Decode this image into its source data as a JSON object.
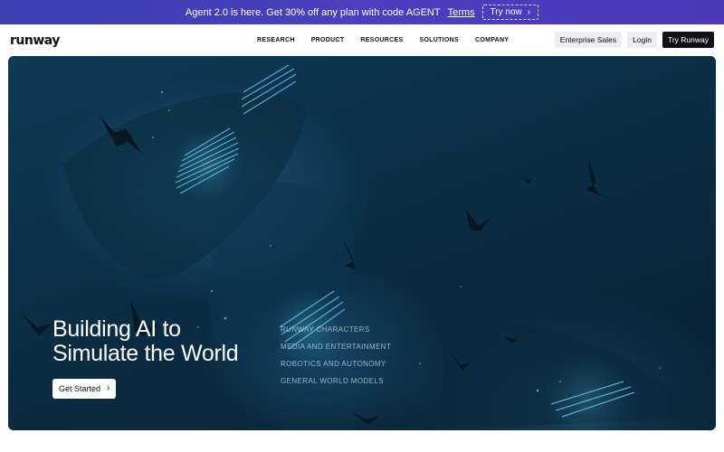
{
  "promo": {
    "text": "Agent 2.0 is here. Get 30% off any plan with code AGENT",
    "terms_label": "Terms",
    "button_label": "Try now"
  },
  "header": {
    "logo": "runway",
    "nav": [
      "RESEARCH",
      "PRODUCT",
      "RESOURCES",
      "SOLUTIONS",
      "COMPANY"
    ],
    "enterprise_label": "Enterprise Sales",
    "login_label": "Login",
    "try_label": "Try Runway"
  },
  "hero": {
    "title_line1": "Building AI to",
    "title_line2": "Simulate the World",
    "cta_label": "Get Started",
    "links": [
      "RUNWAY CHARACTERS",
      "MEDIA AND ENTERTAINMENT",
      "ROBOTICS AND AUTONOMY",
      "GENERAL WORLD MODELS"
    ]
  },
  "colors": {
    "promo_bg": "#4040b8",
    "hero_bg": "#0b3049",
    "primary_button": "#0f1114"
  }
}
